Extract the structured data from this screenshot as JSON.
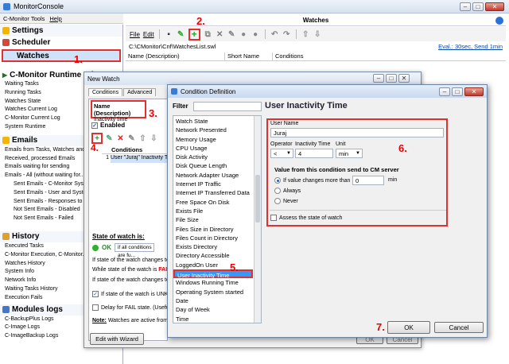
{
  "app": {
    "title": "MonitorConsole"
  },
  "menu": {
    "tools": "C-Monitor Tools",
    "help": "Help"
  },
  "sidebar": {
    "settings": "Settings",
    "scheduler": "Scheduler",
    "watches": "Watches",
    "runtime": "C-Monitor Runtime Info",
    "runtime_items": [
      "Waiting Tasks",
      "Running Tasks",
      "Watches State",
      "Watches Current Log",
      "C-Monitor Current Log",
      "System Runtime"
    ],
    "emails": "Emails",
    "emails_items": [
      "Emails from Tasks, Watches and...",
      "Received, processed Emails",
      "Emails waiting for sending",
      "Emails - All (without waiting for..."
    ],
    "emails_sub": [
      "Sent Emails - C-Monitor Sys...",
      "Sent Emails - User and Syste...",
      "Sent Emails - Responses to ...",
      "Not Sent Emails - Disabled",
      "Not Sent Emails - Failed"
    ],
    "history": "History",
    "history_items": [
      "Executed Tasks",
      "C-Monitor Execution, C-Monitor...",
      "Watches History",
      "System Info",
      "Network Info",
      "Waiting Tasks History",
      "Execution Fails"
    ],
    "modules": "Modules logs",
    "modules_items": [
      "C-BackupPlus Logs",
      "C-Image Logs",
      "C-ImageBackup Logs"
    ]
  },
  "main": {
    "title": "Watches",
    "file_menu": "File",
    "edit_menu": "Edit",
    "path": "C:\\CMonitor\\Cnf\\WatchesList.swl",
    "eval_link": "Eval.: 30sec, Send 1min",
    "columns": [
      "Name (Description)",
      "Short Name",
      "Conditions"
    ]
  },
  "new_watch": {
    "title": "New Watch",
    "tabs": [
      "Conditions",
      "Advanced"
    ],
    "name_label": "Name (Description)",
    "name_value": "Inactivity time",
    "enabled_label": "Enabled",
    "conditions_header": "Conditions",
    "condition_row_num": "1",
    "condition_row_text": "User \"Juraj\" Inactivity T...",
    "state_label": "State of watch is:",
    "ok_label": "OK",
    "ok_select": "if all conditions are fu...",
    "text1": "If state of the watch changes to",
    "text2_pre": "While state of the watch is ",
    "text2_fail": "FAIL",
    "text3": "If state of the watch changes to",
    "chk1": "If state of the watch is UNKN...",
    "chk2": "Delay for FAIL state. (Useful...",
    "note_bold": "Note:",
    "note_rest": " Watches are active from C-...",
    "wizard_button": "Edit with Wizard"
  },
  "condition": {
    "title": "Condition Definition",
    "filter_label": "Filter",
    "filter_value": "",
    "list": [
      "Watch State",
      "Network Presented",
      "Memory Usage",
      "CPU Usage",
      "Disk Activity",
      "Disk Queue Length",
      "Network Adapter Usage",
      "Internet IP Traffic",
      "Internet IP Transferred Data",
      "Free Space On Disk",
      "Exists File",
      "File Size",
      "Files Size in Directory",
      "Files Count in Directory",
      "Exists Directory",
      "Directory Accessible",
      "LoggedOn User",
      "User Inactivity Time",
      "Windows Running Time",
      "Operating System started",
      "Date",
      "Day of Week",
      "Time"
    ],
    "selected_index": 17,
    "heading": "User Inactivity Time",
    "username_label": "User Name",
    "username_value": "Juraj",
    "operator_label": "Operator",
    "operator_value": "<",
    "inactivity_label": "Inactivity Time",
    "inactivity_value": "4",
    "unit_label": "Unit",
    "unit_value": "min",
    "send_title": "Value from this condition send to CM server",
    "radio1": "If value changes more than",
    "radio1_value": "0",
    "radio1_unit": "min",
    "radio2": "Always",
    "radio3": "Never",
    "assess": "Assess the state of watch",
    "ok": "OK",
    "cancel": "Cancel"
  },
  "bg_buttons": {
    "ok": "OK",
    "cancel": "Cancel"
  },
  "annotations": [
    "1.",
    "2.",
    "3.",
    "4.",
    "5.",
    "6.",
    "7."
  ],
  "colors": {
    "accent": "#3399ff",
    "annotation": "#e03030",
    "header": "#d6e1ef"
  }
}
